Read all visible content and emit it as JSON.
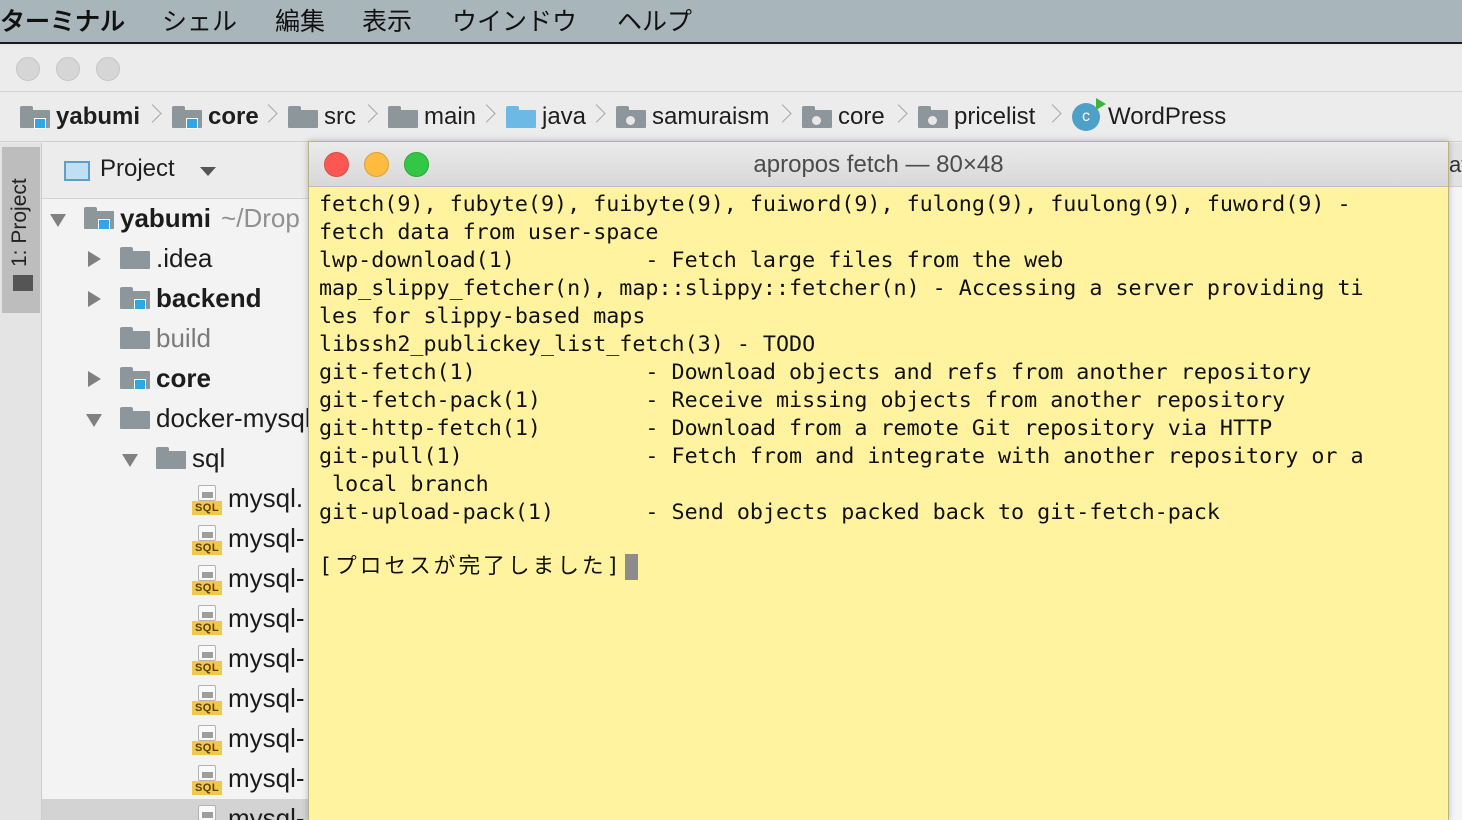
{
  "menubar": {
    "items": [
      "ターミナル",
      "シェル",
      "編集",
      "表示",
      "ウインドウ",
      "ヘルプ"
    ]
  },
  "breadcrumbs": {
    "items": [
      "yabumi",
      "core",
      "src",
      "main",
      "java",
      "samuraism",
      "core",
      "pricelist",
      "WordPress"
    ]
  },
  "class_icon_letter": "c",
  "toolstrip": {
    "project_tab": "1: Project"
  },
  "project_panel": {
    "title": "Project",
    "tree": [
      {
        "label": "yabumi",
        "path": "~/Drop"
      },
      {
        "label": ".idea"
      },
      {
        "label": "backend"
      },
      {
        "label": "build"
      },
      {
        "label": "core"
      },
      {
        "label": "docker-mysql"
      },
      {
        "label": "sql"
      },
      {
        "label": "mysql."
      },
      {
        "label": "mysql-"
      },
      {
        "label": "mysql-"
      },
      {
        "label": "mysql-"
      },
      {
        "label": "mysql-"
      },
      {
        "label": "mysql-"
      },
      {
        "label": "mysql-"
      },
      {
        "label": "mysql-"
      },
      {
        "label": "mysql-"
      }
    ],
    "sql_badge": "SQL"
  },
  "editor_tab_peek": "av",
  "terminal": {
    "title": "apropos fetch — 80×48",
    "lines": [
      "fetch(9), fubyte(9), fuibyte(9), fuiword(9), fulong(9), fuulong(9), fuword(9) -",
      "fetch data from user-space",
      "lwp-download(1)          - Fetch large files from the web",
      "map_slippy_fetcher(n), map::slippy::fetcher(n) - Accessing a server providing ti",
      "les for slippy-based maps",
      "libssh2_publickey_list_fetch(3) - TODO",
      "git-fetch(1)             - Download objects and refs from another repository",
      "git-fetch-pack(1)        - Receive missing objects from another repository",
      "git-http-fetch(1)        - Download from a remote Git repository via HTTP",
      "git-pull(1)              - Fetch from and integrate with another repository or a",
      " local branch",
      "git-upload-pack(1)       - Send objects packed back to git-fetch-pack",
      ""
    ],
    "status": "[プロセスが完了しました]"
  },
  "colors": {
    "terminal_bg": "#fff39f",
    "menubar_bg": "#a8b5ba",
    "close": "#fc5753",
    "minimize": "#fdbc40",
    "zoom": "#33c748"
  }
}
